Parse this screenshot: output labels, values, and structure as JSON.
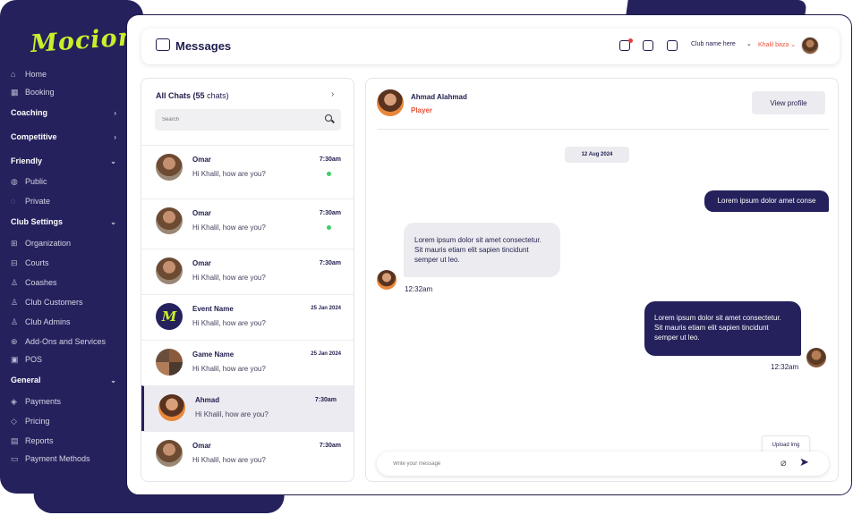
{
  "brand": {
    "logo": "Mocion",
    "accent": "#c8ef2a",
    "navy": "#24215c"
  },
  "sidebar": {
    "items": [
      {
        "type": "item",
        "label": "Home",
        "icon": "home-icon",
        "glyph": "⌂"
      },
      {
        "type": "item",
        "label": "Booking",
        "icon": "calendar-icon",
        "glyph": "▦"
      },
      {
        "type": "head",
        "label": "Coaching",
        "chev": "›"
      },
      {
        "type": "head",
        "label": "Competitive",
        "chev": "›"
      },
      {
        "type": "head",
        "label": "Friendly",
        "chev": "⌄"
      },
      {
        "type": "item",
        "label": "Public",
        "icon": "globe-icon",
        "glyph": "◍"
      },
      {
        "type": "item",
        "label": "Private",
        "icon": "private-icon",
        "glyph": "◌"
      },
      {
        "type": "head",
        "label": "Club Settings",
        "chev": "⌄"
      },
      {
        "type": "item",
        "label": "Organization",
        "icon": "organization-icon",
        "glyph": "⊞"
      },
      {
        "type": "item",
        "label": "Courts",
        "icon": "courts-icon",
        "glyph": "⊟"
      },
      {
        "type": "item",
        "label": "Coashes",
        "icon": "coach-icon",
        "glyph": "♙"
      },
      {
        "type": "item",
        "label": "Club Customers",
        "icon": "customers-icon",
        "glyph": "♙"
      },
      {
        "type": "item",
        "label": "Club Admins",
        "icon": "admins-icon",
        "glyph": "♙"
      },
      {
        "type": "item",
        "label": "Add-Ons and Services",
        "icon": "addons-icon",
        "glyph": "⊕"
      },
      {
        "type": "item",
        "label": "POS",
        "icon": "pos-icon",
        "glyph": "▣"
      },
      {
        "type": "head",
        "label": "General",
        "chev": "⌄"
      },
      {
        "type": "item",
        "label": "Payments",
        "icon": "payments-icon",
        "glyph": "◈"
      },
      {
        "type": "item",
        "label": "Pricing",
        "icon": "pricing-icon",
        "glyph": "◇"
      },
      {
        "type": "item",
        "label": "Reports",
        "icon": "reports-icon",
        "glyph": "▤"
      },
      {
        "type": "item",
        "label": "Payment Methods",
        "icon": "card-icon",
        "glyph": "▭"
      }
    ]
  },
  "header": {
    "title": "Messages",
    "club_name": "Club name here",
    "user_name": "Khalil baza",
    "chevron": "⌄"
  },
  "chat_list": {
    "title": "All Chats",
    "count": "(55",
    "count_suffix": "chats)",
    "arrow": "›",
    "search_placeholder": "Search",
    "chats": [
      {
        "name": "Omar",
        "message": "Hi Khalil, how are you?",
        "time": "7:30am",
        "online": true,
        "avatar": "person"
      },
      {
        "name": "Omar",
        "message": "Hi Khalil, how are you?",
        "time": "7:30am",
        "online": true,
        "avatar": "person"
      },
      {
        "name": "Omar",
        "message": "Hi Khalil, how are you?",
        "time": "7:30am",
        "online": false,
        "avatar": "person"
      },
      {
        "name": "Event Name",
        "message": "Hi Khalil, how are you?",
        "time": "25 Jan 2024",
        "online": false,
        "avatar": "brand"
      },
      {
        "name": "Game Name",
        "message": "Hi Khalil, how are you?",
        "time": "25 Jan 2024",
        "online": false,
        "avatar": "group"
      },
      {
        "name": "Ahmad",
        "message": "Hi Khalil, how are you?",
        "time": "7:30am",
        "online": false,
        "avatar": "orange",
        "active": true
      },
      {
        "name": "Omar",
        "message": "Hi Khalil, how are you?",
        "time": "7:30am",
        "online": false,
        "avatar": "person"
      }
    ]
  },
  "conversation": {
    "contact_name": "Ahmad Alahmad",
    "contact_role": "Player",
    "view_profile": "View profile",
    "date": "12 Aug 2024",
    "outgoing_1": "Lorem ipsum dolor amet conse",
    "incoming_1": "Lorem ipsum dolor sit amet consectetur. Sit mauris etiam elit sapien tincidunt semper ut leo.",
    "incoming_1_time": "12:32am",
    "outgoing_2": "Lorem ipsum dolor sit amet consectetur. Sit mauris etiam elit sapien tincidunt semper ut leo.",
    "outgoing_2_time": "12:32am",
    "upload_tooltip": "Upload Img",
    "composer_placeholder": "Write your message",
    "attach_glyph": "⌀",
    "send_glyph": "➤"
  }
}
